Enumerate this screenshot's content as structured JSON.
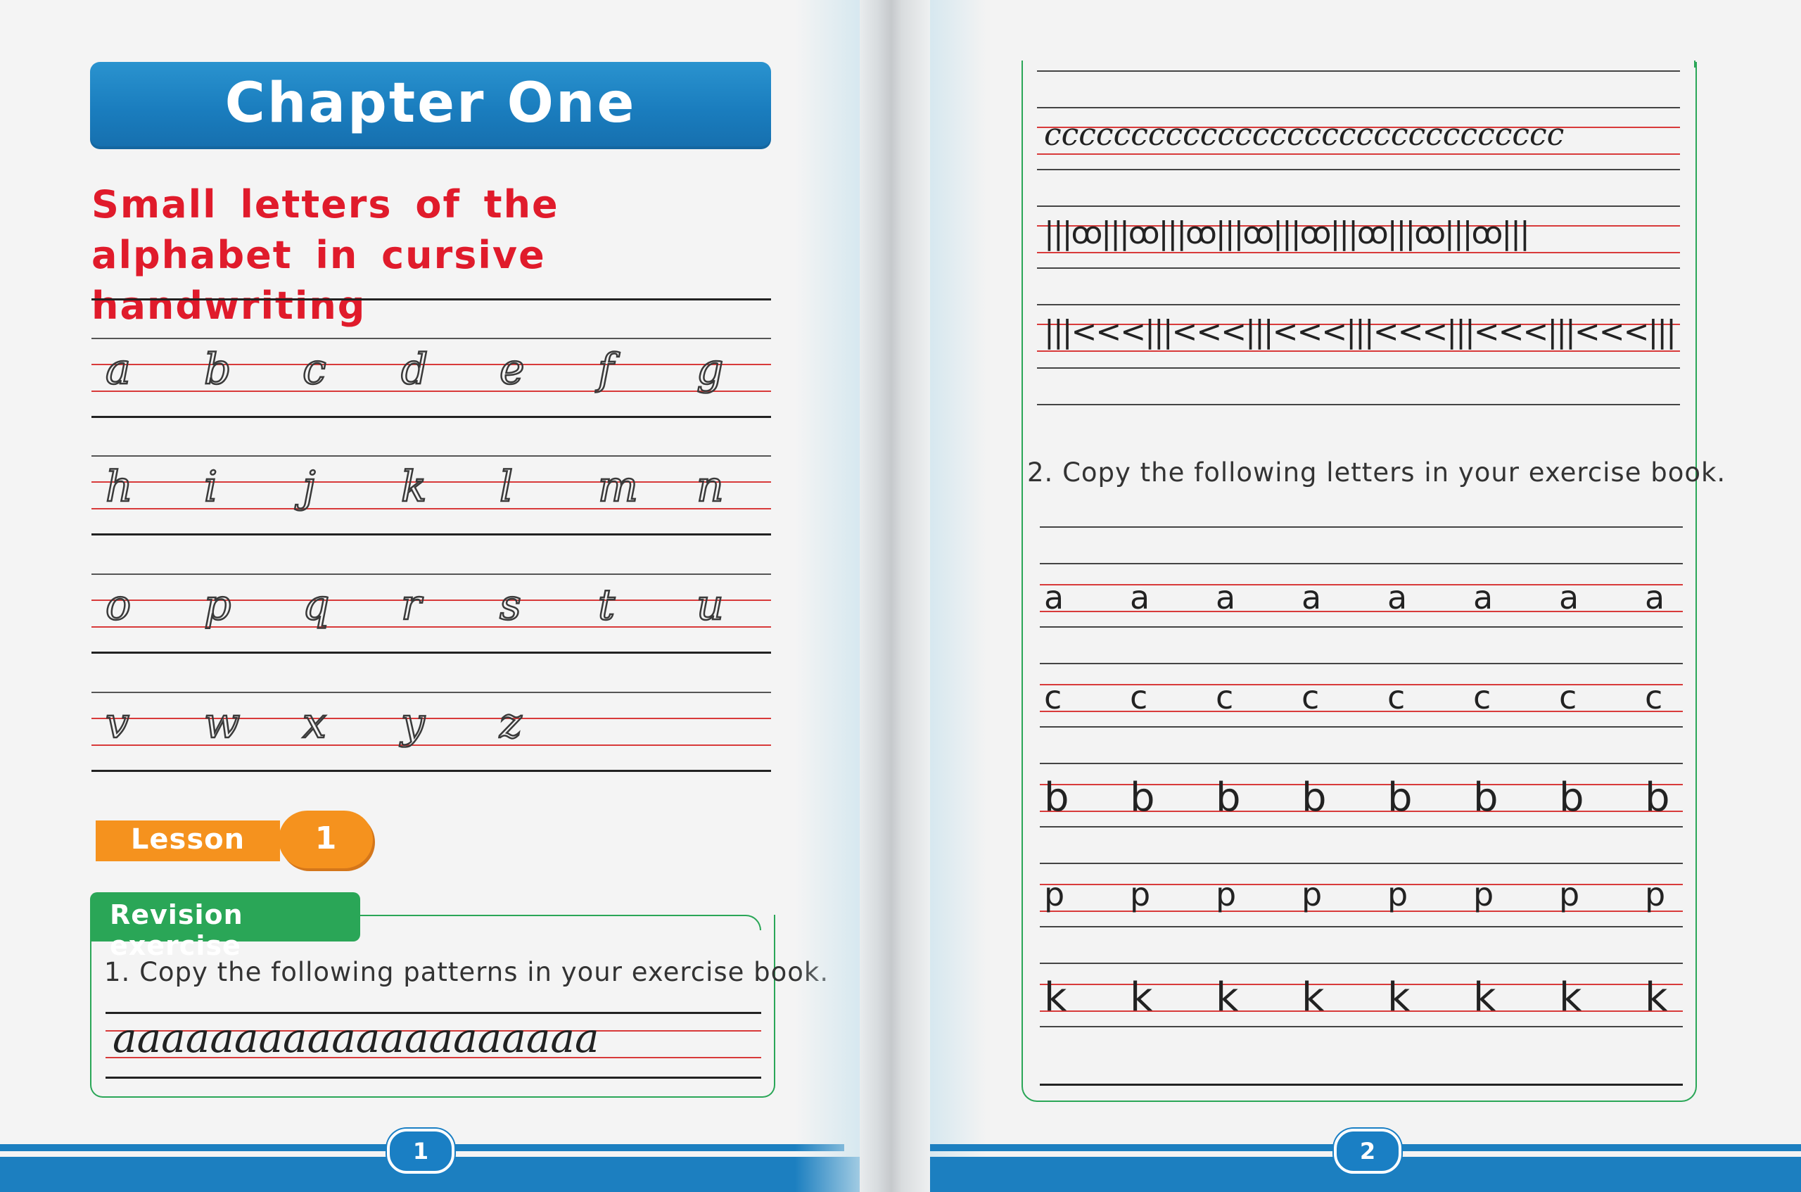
{
  "left_page": {
    "chapter_title": "Chapter One",
    "subtitle": "Small letters of the alphabet in cursive handwriting",
    "cursive_rows": [
      [
        "a",
        "b",
        "c",
        "d",
        "e",
        "f",
        "g"
      ],
      [
        "h",
        "i",
        "j",
        "k",
        "l",
        "m",
        "n"
      ],
      [
        "o",
        "p",
        "q",
        "r",
        "s",
        "t",
        "u"
      ],
      [
        "v",
        "w",
        "x",
        "y",
        "z"
      ]
    ],
    "lesson_label": "Lesson",
    "lesson_number": "1",
    "revision_label": "Revision exercise",
    "exercise1_instruction": "1. Copy the following patterns in your exercise book.",
    "exercise1_pattern": "aaaaaaaaaaaaaaaaaaaa",
    "page_number": "1"
  },
  "right_page": {
    "patterns": {
      "row1": "cccccccccccccccccccccccccccccc",
      "row2": "|||ꝏ|||ꝏ|||ꝏ|||ꝏ|||ꝏ|||ꝏ|||ꝏ|||ꝏ|||",
      "row3": "|||<<<|||<<<|||<<<|||<<<|||<<<|||<<<|||<<<|||<<"
    },
    "exercise2_instruction": "2. Copy the following letters in your exercise book.",
    "letter_rows": [
      {
        "letter": "a",
        "count": 8
      },
      {
        "letter": "c",
        "count": 8
      },
      {
        "letter": "b",
        "count": 8
      },
      {
        "letter": "p",
        "count": 8
      },
      {
        "letter": "k",
        "count": 8
      }
    ],
    "page_number": "2"
  },
  "colors": {
    "banner_blue": "#1a7dbe",
    "title_red": "#e01b2b",
    "lesson_orange": "#f5921e",
    "revision_green": "#2aa657",
    "guide_red": "#d83a3a"
  }
}
